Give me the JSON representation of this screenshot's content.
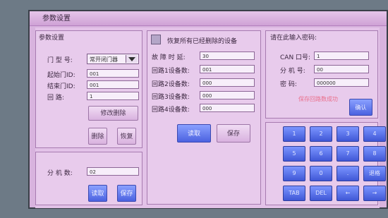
{
  "window": {
    "title": "参数设置"
  },
  "left_panel": {
    "title": "参数设置",
    "door_type_label": "门 型 号:",
    "door_type_value": "常开闭门器",
    "start_id_label": "起始门ID:",
    "start_id_value": "001",
    "end_id_label": "结束门ID:",
    "end_id_value": "001",
    "loop_label": "回    路:",
    "loop_value": "1",
    "modify_delete_label": "修改删除",
    "delete_label": "删除",
    "restore_label": "恢复",
    "extension_count_label": "分 机 数:",
    "extension_count_value": "02",
    "read_label": "读取",
    "save_label": "保存"
  },
  "middle_panel": {
    "restore_all_label": "恢复所有已经删除的设备",
    "delay_label": "故 障 时 延:",
    "delay_value": "30",
    "loop1_label": "回路1设备数:",
    "loop1_value": "001",
    "loop2_label": "回路2设备数:",
    "loop2_value": "000",
    "loop3_label": "回路3设备数:",
    "loop3_value": "000",
    "loop4_label": "回路4设备数:",
    "loop4_value": "000",
    "read_label": "读取",
    "save_label": "保存"
  },
  "right_panel": {
    "title": "请在此输入密码:",
    "can_label": "CAN 口号:",
    "can_value": "1",
    "ext_label": "分 机 号:",
    "ext_value": "00",
    "pwd_label": "密    码:",
    "pwd_value": "000000",
    "hint": "保存回路数成功",
    "confirm_label": "确认"
  },
  "keypad": {
    "keys": [
      "1",
      "2",
      "3",
      "4",
      "5",
      "6",
      "7",
      "8",
      "9",
      "0",
      ".",
      "退格",
      "TAB",
      "DEL",
      "←",
      "→"
    ]
  },
  "colors": {
    "button_blue": "#4b62e0",
    "panel_bg": "#e8cbec",
    "hint": "#ea6f8b"
  }
}
